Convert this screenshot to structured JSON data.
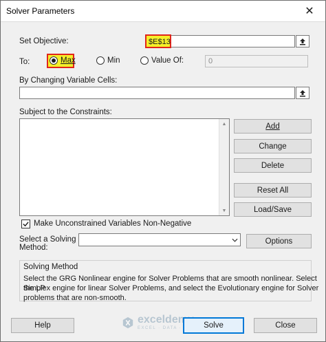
{
  "window": {
    "title": "Solver Parameters",
    "close_glyph": "✕"
  },
  "objective": {
    "label": "Set Objective:",
    "value": "$E$13"
  },
  "to": {
    "label": "To:",
    "options": [
      {
        "label": "Max",
        "selected": true
      },
      {
        "label": "Min",
        "selected": false
      },
      {
        "label": "Value Of:",
        "selected": false
      }
    ],
    "value_of": "0"
  },
  "changing_cells": {
    "label": "By Changing Variable Cells:",
    "value": ""
  },
  "constraints": {
    "label": "Subject to the Constraints:",
    "buttons": {
      "add": "Add",
      "change": "Change",
      "delete": "Delete",
      "reset_all": "Reset All",
      "load_save": "Load/Save"
    }
  },
  "nonnegative": {
    "label": "Make Unconstrained Variables Non-Negative",
    "checked": true
  },
  "method": {
    "label_line1": "Select a Solving",
    "label_line2": "Method:",
    "selected": "",
    "options_button": "Options"
  },
  "solving_method": {
    "title": "Solving Method",
    "text_lines": [
      "Select the GRG Nonlinear engine for Solver Problems that are smooth nonlinear. Select the LP",
      "Simplex engine for linear Solver Problems, and select the Evolutionary engine for Solver",
      "problems that are non-smooth."
    ]
  },
  "footer": {
    "help": "Help",
    "solve": "Solve",
    "close": "Close"
  },
  "watermark": {
    "name": "exceldemy",
    "tagline": "EXCEL · DATA · BI"
  },
  "icons": {
    "ref_button": "range-select-icon",
    "check": "checkmark-icon",
    "dropdown": "chevron-down-icon",
    "scroll_up": "scroll-up-icon",
    "scroll_down": "scroll-down-icon"
  },
  "colors": {
    "highlight_fill": "#f5ef2a",
    "highlight_border": "#e0251b",
    "default_button_border": "#0078d7"
  }
}
